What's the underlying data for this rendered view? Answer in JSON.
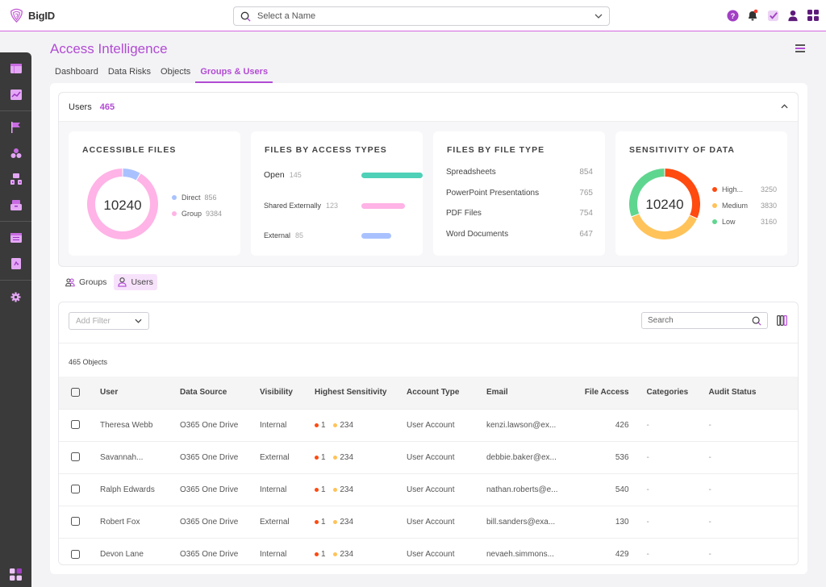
{
  "app": {
    "name": "BigID"
  },
  "header": {
    "name_select_placeholder": "Select a Name",
    "icons": [
      "help-icon",
      "notification-bell-icon",
      "tasks-check-icon",
      "user-profile-icon",
      "apps-grid-icon"
    ]
  },
  "sidebar": {
    "items": [
      {
        "icon": "dashboard-icon"
      },
      {
        "icon": "analytics-chart-icon"
      },
      {
        "icon": "flag-icon"
      },
      {
        "icon": "data-catalog-icon"
      },
      {
        "icon": "hierarchy-icon"
      },
      {
        "icon": "inbox-icon"
      },
      {
        "icon": "reports-icon"
      },
      {
        "icon": "document-icon"
      },
      {
        "icon": "settings-gear-icon"
      }
    ],
    "bottom_icon": "apps-grid-icon"
  },
  "page": {
    "title": "Access Intelligence",
    "tabs": [
      {
        "label": "Dashboard",
        "active": false
      },
      {
        "label": "Data Risks",
        "active": false
      },
      {
        "label": "Objects",
        "active": false
      },
      {
        "label": "Groups & Users",
        "active": true
      }
    ]
  },
  "summary": {
    "label": "Users",
    "count": "465",
    "accessible_files": {
      "title": "ACCESSIBLE FILES",
      "total": "10240",
      "legend": [
        {
          "label": "Direct",
          "value": "856",
          "color": "#a9c2ff"
        },
        {
          "label": "Group",
          "value": "9384",
          "color": "#ffb3e6"
        }
      ]
    },
    "access_types": {
      "title": "FILES BY ACCESS TYPES",
      "items": [
        {
          "label": "Open",
          "value": "145",
          "color": "#4fd1b8",
          "fraction": 1.0
        },
        {
          "label": "Shared Externally",
          "value": "123",
          "color": "#ffb3e6",
          "fraction": 0.71
        },
        {
          "label": "External",
          "value": "85",
          "color": "#a9c2ff",
          "fraction": 0.49
        }
      ]
    },
    "file_types": {
      "title": "FILES BY FILE TYPE",
      "items": [
        {
          "label": "Spreadsheets",
          "value": "854"
        },
        {
          "label": "PowerPoint Presentations",
          "value": "765"
        },
        {
          "label": "PDF Files",
          "value": "754"
        },
        {
          "label": "Word Documents",
          "value": "647"
        }
      ]
    },
    "sensitivity": {
      "title": "SENSITIVITY OF DATA",
      "total": "10240",
      "legend": [
        {
          "label": "High...",
          "value": "3250",
          "color": "#ff4a10"
        },
        {
          "label": "Medium",
          "value": "3830",
          "color": "#ffc35a"
        },
        {
          "label": "Low",
          "value": "3160",
          "color": "#5fd68f"
        }
      ]
    }
  },
  "toggle": {
    "groups_label": "Groups",
    "users_label": "Users"
  },
  "table": {
    "add_filter_label": "Add Filter",
    "search_placeholder": "Search",
    "object_count": "465 Objects",
    "columns": [
      "User",
      "Data Source",
      "Visibility",
      "Highest Sensitivity",
      "Account Type",
      "Email",
      "File Access",
      "Categories",
      "Audit Status"
    ],
    "rows": [
      {
        "user": "Theresa Webb",
        "source": "O365 One Drive",
        "visibility": "Internal",
        "high": "1",
        "medium": "234",
        "account": "User Account",
        "email": "kenzi.lawson@ex...",
        "access": "426",
        "categories": "-",
        "audit": "-"
      },
      {
        "user": "Savannah...",
        "source": "O365 One Drive",
        "visibility": "External",
        "high": "1",
        "medium": "234",
        "account": "User Account",
        "email": "debbie.baker@ex...",
        "access": "536",
        "categories": "-",
        "audit": "-"
      },
      {
        "user": "Ralph Edwards",
        "source": "O365 One Drive",
        "visibility": "Internal",
        "high": "1",
        "medium": "234",
        "account": "User Account",
        "email": "nathan.roberts@e...",
        "access": "540",
        "categories": "-",
        "audit": "-"
      },
      {
        "user": "Robert Fox",
        "source": "O365 One Drive",
        "visibility": "External",
        "high": "1",
        "medium": "234",
        "account": "User Account",
        "email": "bill.sanders@exa...",
        "access": "130",
        "categories": "-",
        "audit": "-"
      },
      {
        "user": "Devon Lane",
        "source": "O365 One Drive",
        "visibility": "Internal",
        "high": "1",
        "medium": "234",
        "account": "User Account",
        "email": "nevaeh.simmons...",
        "access": "429",
        "categories": "-",
        "audit": "-"
      }
    ]
  },
  "colors": {
    "accent": "#b24bd3",
    "high": "#ff4a10",
    "medium": "#ffc35a"
  }
}
